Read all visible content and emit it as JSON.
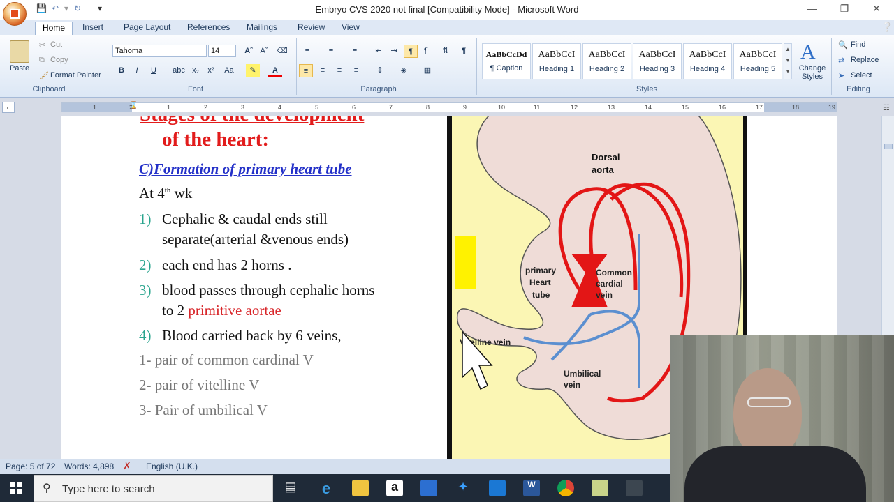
{
  "window": {
    "title": "Embryo CVS 2020 not final [Compatibility Mode] - Microsoft Word"
  },
  "ribbon": {
    "tabs": [
      "Home",
      "Insert",
      "Page Layout",
      "References",
      "Mailings",
      "Review",
      "View"
    ],
    "active_tab": "Home",
    "clipboard": {
      "paste": "Paste",
      "cut": "Cut",
      "copy": "Copy",
      "format_painter": "Format Painter",
      "label": "Clipboard"
    },
    "font": {
      "family": "Tahoma",
      "size": "14",
      "label": "Font"
    },
    "paragraph": {
      "label": "Paragraph"
    },
    "styles": {
      "items": [
        {
          "sample": "AaBbCcDd",
          "name": "¶ Caption"
        },
        {
          "sample": "AaBbCcI",
          "name": "Heading 1"
        },
        {
          "sample": "AaBbCcI",
          "name": "Heading 2"
        },
        {
          "sample": "AaBbCcI",
          "name": "Heading 3"
        },
        {
          "sample": "AaBbCcI",
          "name": "Heading 4"
        },
        {
          "sample": "AaBbCcI",
          "name": "Heading 5"
        }
      ],
      "change_styles": "Change Styles",
      "label": "Styles"
    },
    "editing": {
      "find": "Find",
      "replace": "Replace",
      "select": "Select",
      "label": "Editing"
    }
  },
  "ruler": {
    "ticks": [
      "1",
      "2",
      "1",
      "1",
      "2",
      "3",
      "4",
      "5",
      "6",
      "7",
      "8",
      "9",
      "10",
      "11",
      "12",
      "13",
      "14",
      "15",
      "16",
      "17",
      "18",
      "19"
    ]
  },
  "slide": {
    "title_line1": "Stages of the development",
    "title_line2": "of the heart:",
    "subheading": "C)Formation of primary heart tube",
    "at_week": "At  4",
    "at_week_sup": "th",
    "at_week_tail": " wk",
    "points": [
      {
        "num": "1)",
        "text": "Cephalic & caudal ends  still",
        "text2": "separate(arterial &venous ends)"
      },
      {
        "num": "2)",
        "text": "each end has 2 horns ."
      },
      {
        "num": "3)",
        "text": "blood passes through  cephalic horns",
        "text2a": "to 2 ",
        "text2b": "primitive aortae"
      },
      {
        "num": "4)",
        "text": "Blood carried back by 6 veins,"
      }
    ],
    "veins": [
      "1- pair of common cardinal V",
      "2- pair of vitelline V",
      "3- Pair of umbilical V"
    ]
  },
  "diagram": {
    "labels": {
      "dorsal_aorta": [
        "Dorsal",
        "aorta"
      ],
      "primary_heart": [
        "primary",
        "Heart",
        "tube"
      ],
      "common_cardinal": [
        "Common",
        "cardial",
        "vein"
      ],
      "vitelline": "Vitelline vein",
      "umbilical": [
        "Umbilical",
        "vein"
      ]
    }
  },
  "status": {
    "page": "Page: 5 of 72",
    "words": "Words: 4,898",
    "language": "English (U.K.)"
  },
  "taskbar": {
    "search_placeholder": "Type here to search"
  }
}
